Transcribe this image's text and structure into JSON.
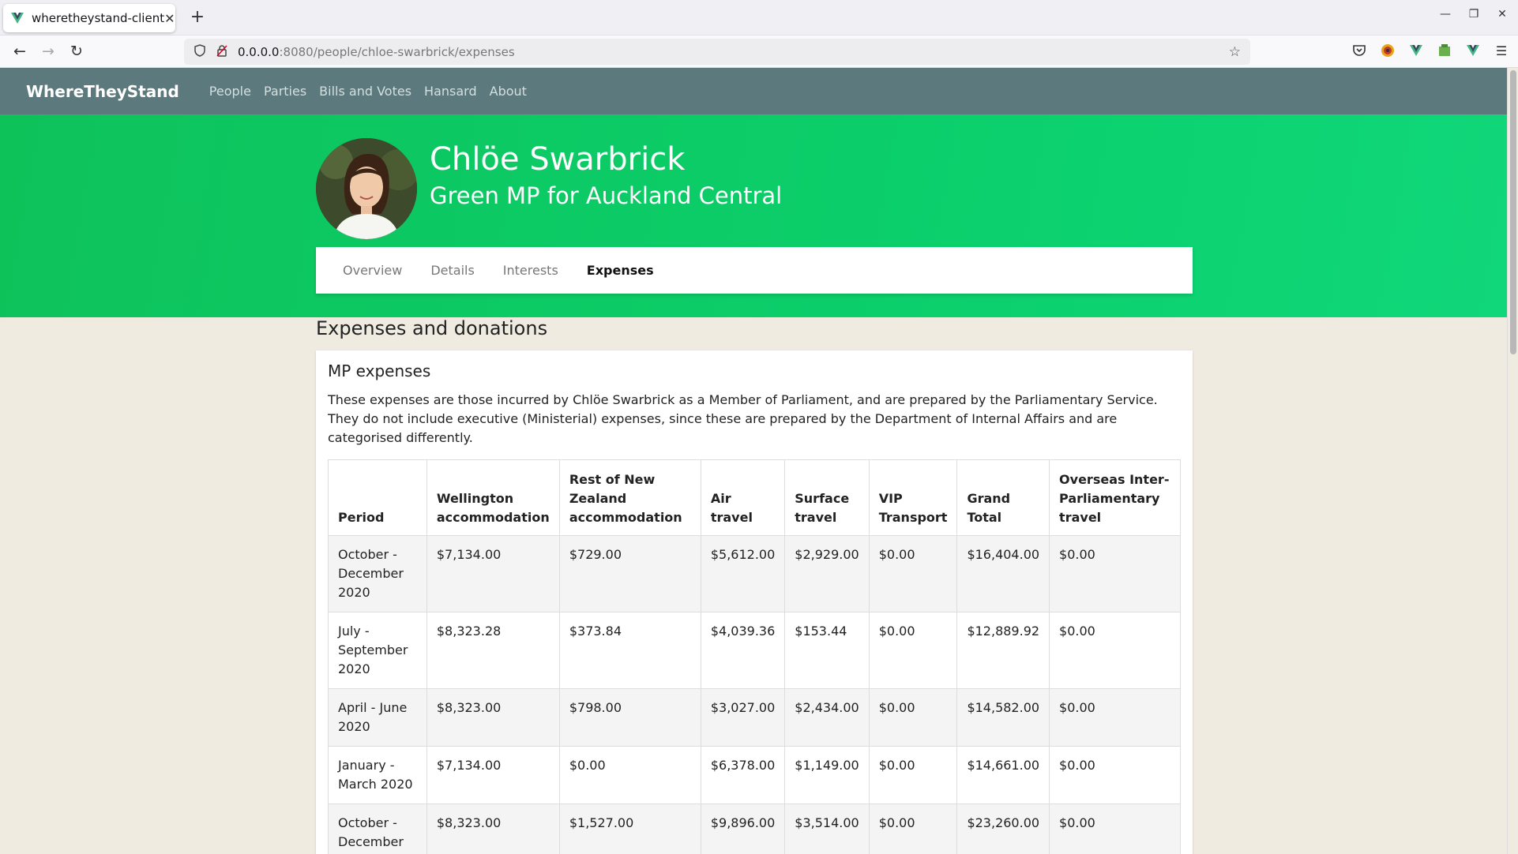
{
  "browser": {
    "tab_title": "wheretheystand-client",
    "url_host": "0.0.0.0",
    "url_path": ":8080/people/chloe-swarbrick/expenses"
  },
  "site": {
    "brand": "WhereTheyStand",
    "nav": [
      "People",
      "Parties",
      "Bills and Votes",
      "Hansard",
      "About"
    ]
  },
  "person": {
    "name": "Chlöe Swarbrick",
    "subtitle": "Green MP for Auckland Central"
  },
  "subnav": {
    "items": [
      "Overview",
      "Details",
      "Interests",
      "Expenses"
    ],
    "active": "Expenses"
  },
  "section": {
    "title": "Expenses and donations"
  },
  "expenses": {
    "title": "MP expenses",
    "description": "These expenses are those incurred by Chlöe Swarbrick as a Member of Parliament, and are prepared by the Parliamentary Service. They do not include executive (Ministerial) expenses, since these are prepared by the Department of Internal Affairs and are categorised differently.",
    "columns": [
      "Period",
      "Wellington accommodation",
      "Rest of New Zealand accommodation",
      "Air travel",
      "Surface travel",
      "VIP Transport",
      "Grand Total",
      "Overseas Inter-Parliamentary travel"
    ],
    "rows": [
      [
        "October - December 2020",
        "$7,134.00",
        "$729.00",
        "$5,612.00",
        "$2,929.00",
        "$0.00",
        "$16,404.00",
        "$0.00"
      ],
      [
        "July - September 2020",
        "$8,323.28",
        "$373.84",
        "$4,039.36",
        "$153.44",
        "$0.00",
        "$12,889.92",
        "$0.00"
      ],
      [
        "April - June 2020",
        "$8,323.00",
        "$798.00",
        "$3,027.00",
        "$2,434.00",
        "$0.00",
        "$14,582.00",
        "$0.00"
      ],
      [
        "January - March 2020",
        "$7,134.00",
        "$0.00",
        "$6,378.00",
        "$1,149.00",
        "$0.00",
        "$14,661.00",
        "$0.00"
      ],
      [
        "October - December",
        "$8,323.00",
        "$1,527.00",
        "$9,896.00",
        "$3,514.00",
        "$0.00",
        "$23,260.00",
        "$0.00"
      ]
    ]
  }
}
